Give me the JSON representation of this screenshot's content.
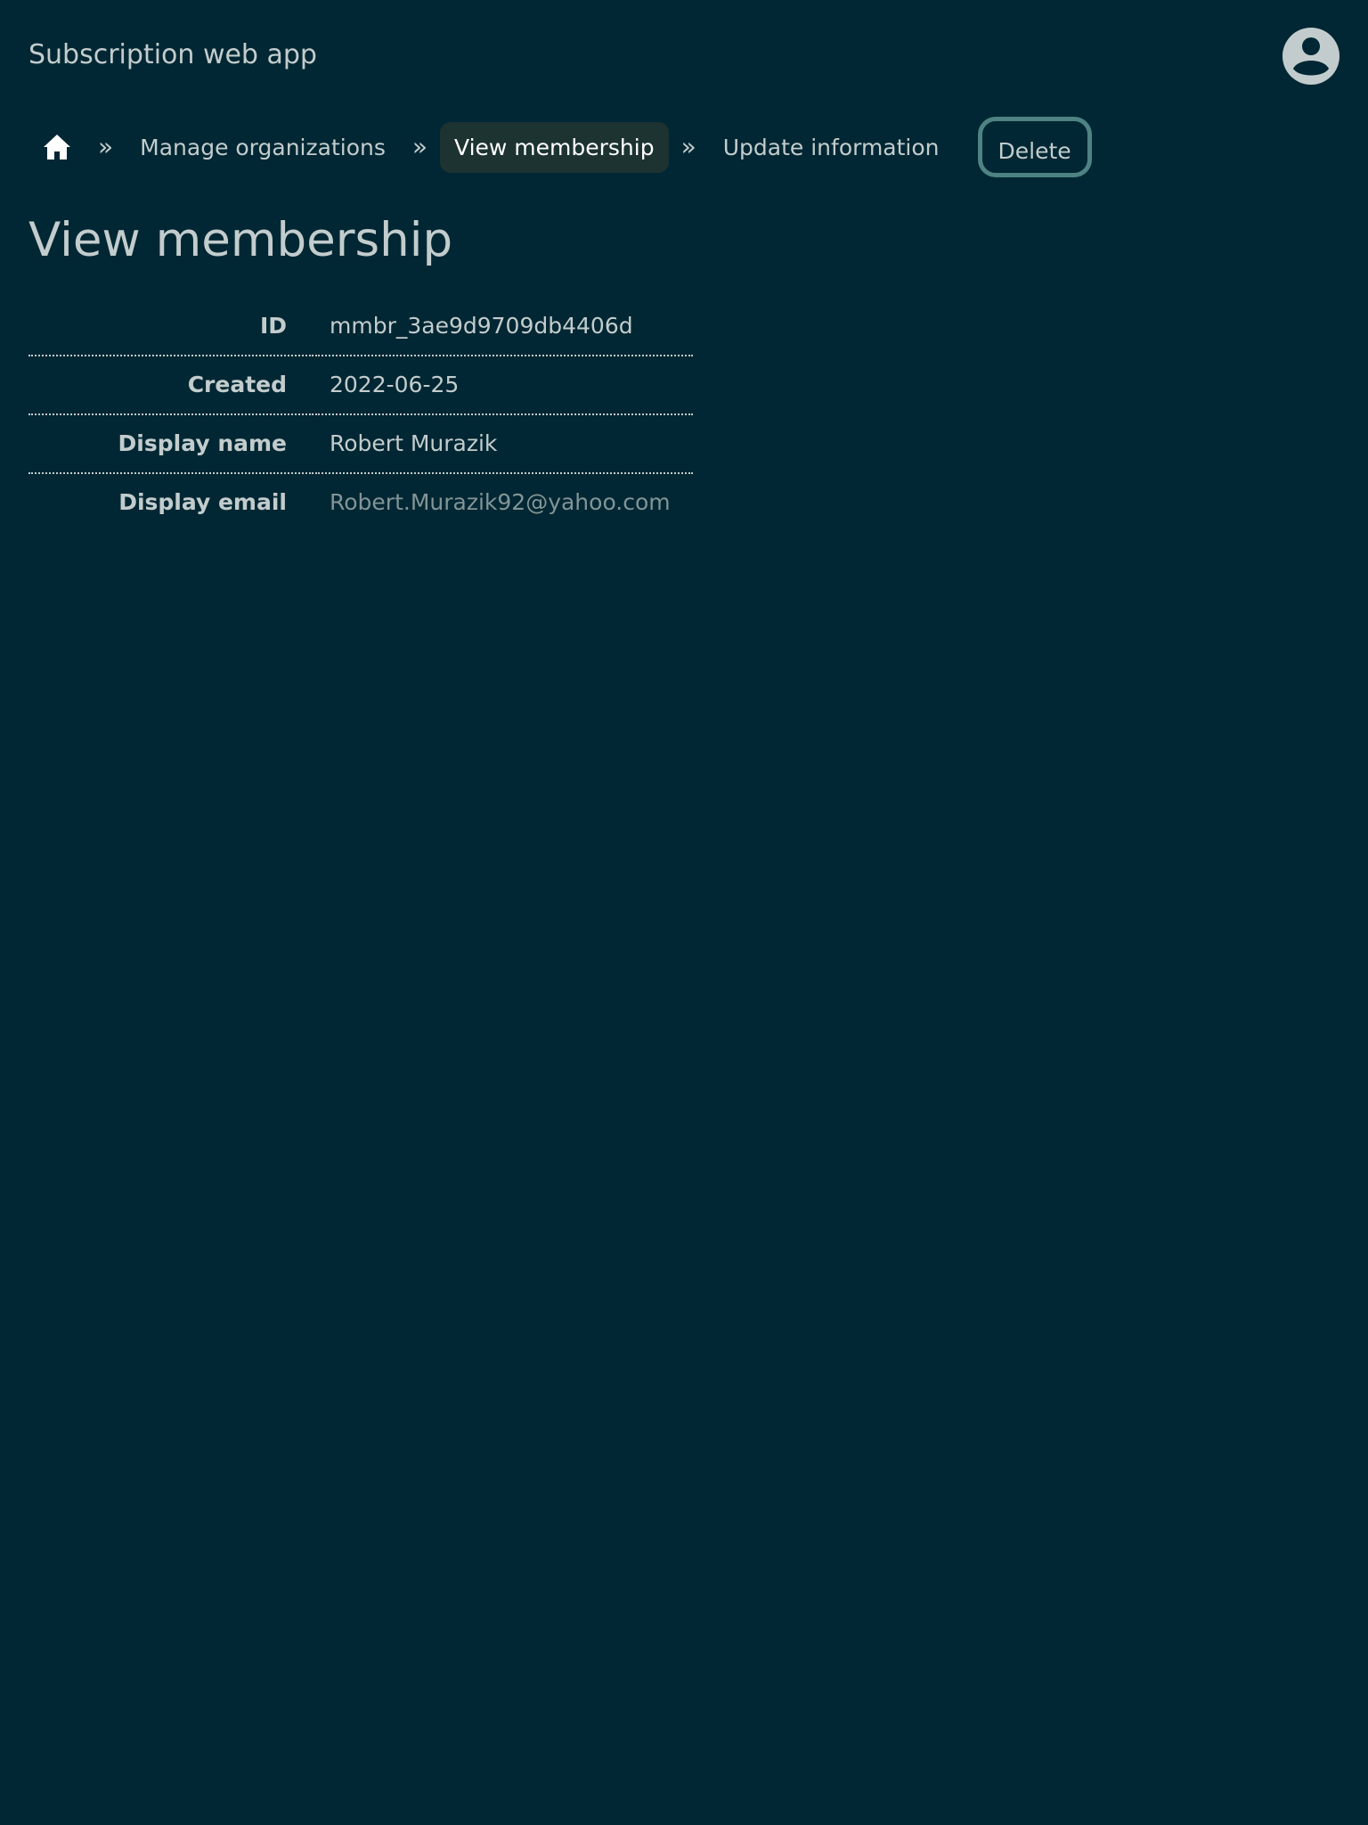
{
  "app": {
    "title": "Subscription web app"
  },
  "breadcrumb": {
    "home_icon": "home-icon",
    "separator": "»",
    "items": [
      {
        "label": "Manage organizations"
      },
      {
        "label": "View membership"
      },
      {
        "label": "Update information"
      }
    ],
    "delete_label": "Delete"
  },
  "page": {
    "title": "View membership"
  },
  "details": {
    "rows": [
      {
        "label": "ID",
        "value": "mmbr_3ae9d9709db4406d"
      },
      {
        "label": "Created",
        "value": "2022-06-25"
      },
      {
        "label": "Display name",
        "value": "Robert Murazik"
      },
      {
        "label": "Display email",
        "value": "Robert.Murazik92@yahoo.com"
      }
    ]
  },
  "colors": {
    "background": "#002733",
    "text": "#c3cccd",
    "current_crumb_bg": "#1c3331",
    "delete_border": "#4e8283",
    "muted_text": "#839496"
  },
  "icons": {
    "avatar": "account-circle-icon",
    "home": "home-icon"
  }
}
